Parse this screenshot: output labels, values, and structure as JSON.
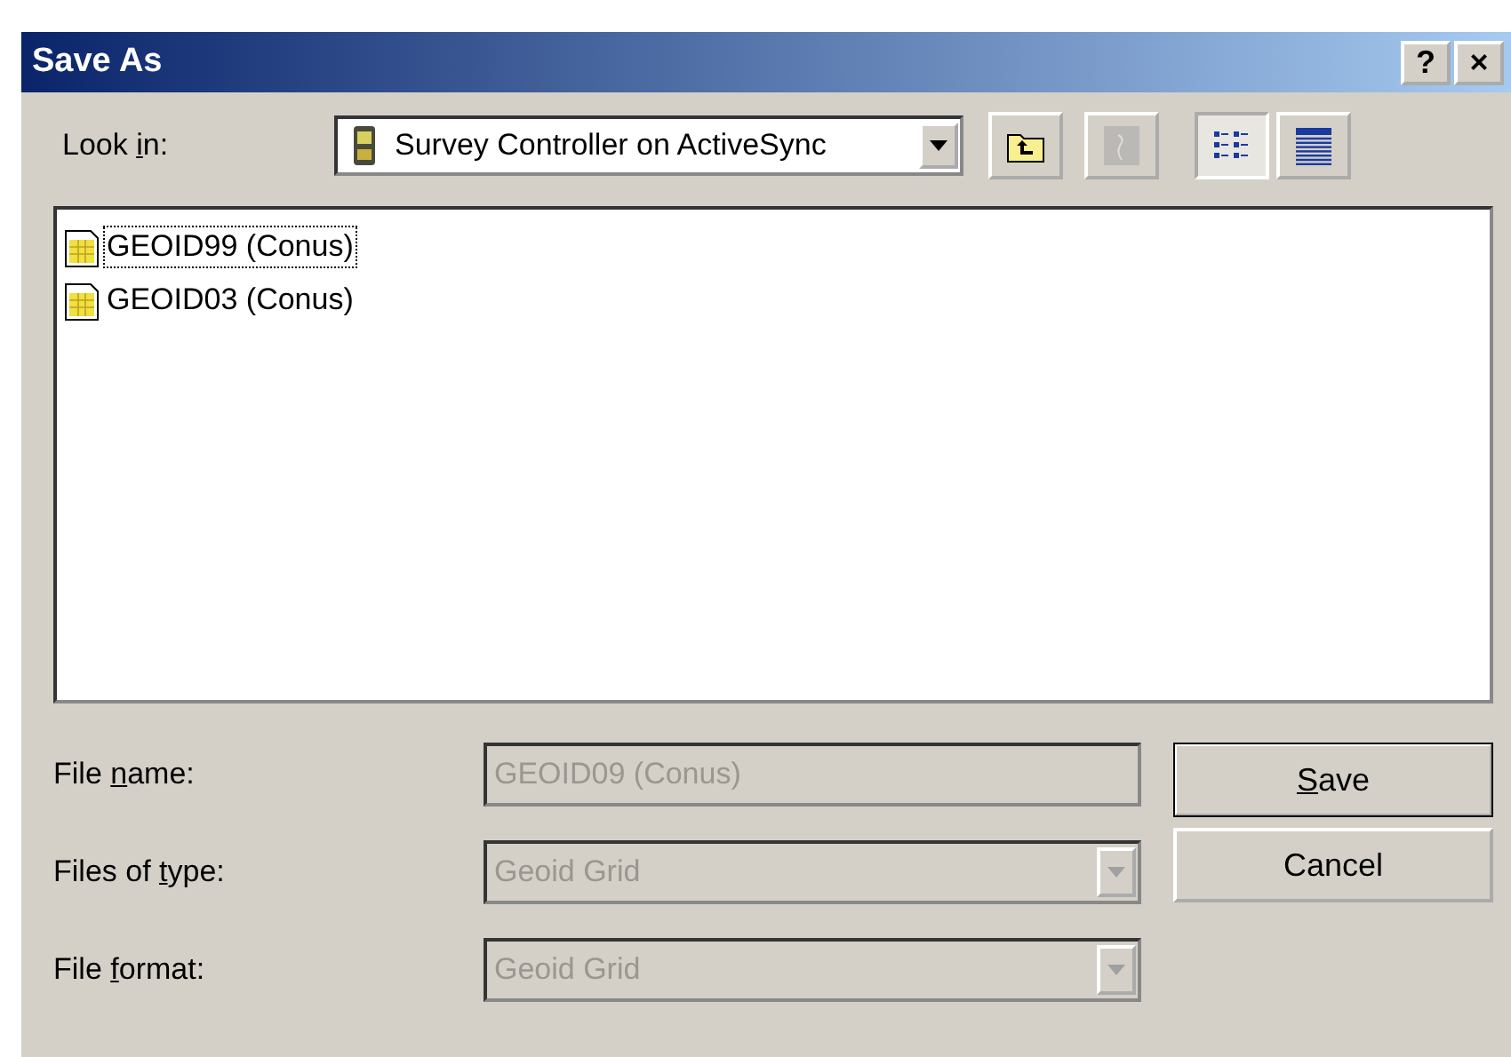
{
  "window": {
    "title": "Save As",
    "title_buttons": [
      "?",
      "×"
    ]
  },
  "look_in": {
    "label": {
      "before": "Look ",
      "key": "i",
      "after": "n:"
    },
    "value": "Survey Controller on ActiveSync"
  },
  "toolbar": [
    {
      "kind": "up-folder",
      "disabled": false,
      "selected": false
    },
    {
      "kind": "desktop",
      "disabled": true,
      "selected": false
    },
    {
      "kind": "list-view",
      "disabled": false,
      "selected": true
    },
    {
      "kind": "details-view",
      "disabled": false,
      "selected": false
    }
  ],
  "files": [
    {
      "name": "GEOID99 (Conus)",
      "selected": true
    },
    {
      "name": "GEOID03 (Conus)",
      "selected": false
    }
  ],
  "fields": [
    {
      "kind": "text",
      "label": {
        "before": "File ",
        "key": "n",
        "after": "ame:"
      },
      "value": "GEOID09 (Conus)",
      "disabled": true
    },
    {
      "kind": "dropdown",
      "label": {
        "before": "Files of ",
        "key": "t",
        "after": "ype:"
      },
      "value": "Geoid Grid",
      "disabled": true
    },
    {
      "kind": "dropdown",
      "label": {
        "before": "File ",
        "key": "f",
        "after": "ormat:"
      },
      "value": "Geoid Grid",
      "disabled": true
    }
  ],
  "buttons": [
    {
      "label": {
        "key": "S",
        "after": "ave"
      },
      "default": true
    },
    {
      "label": {
        "before": "Cancel"
      },
      "default": false
    }
  ]
}
